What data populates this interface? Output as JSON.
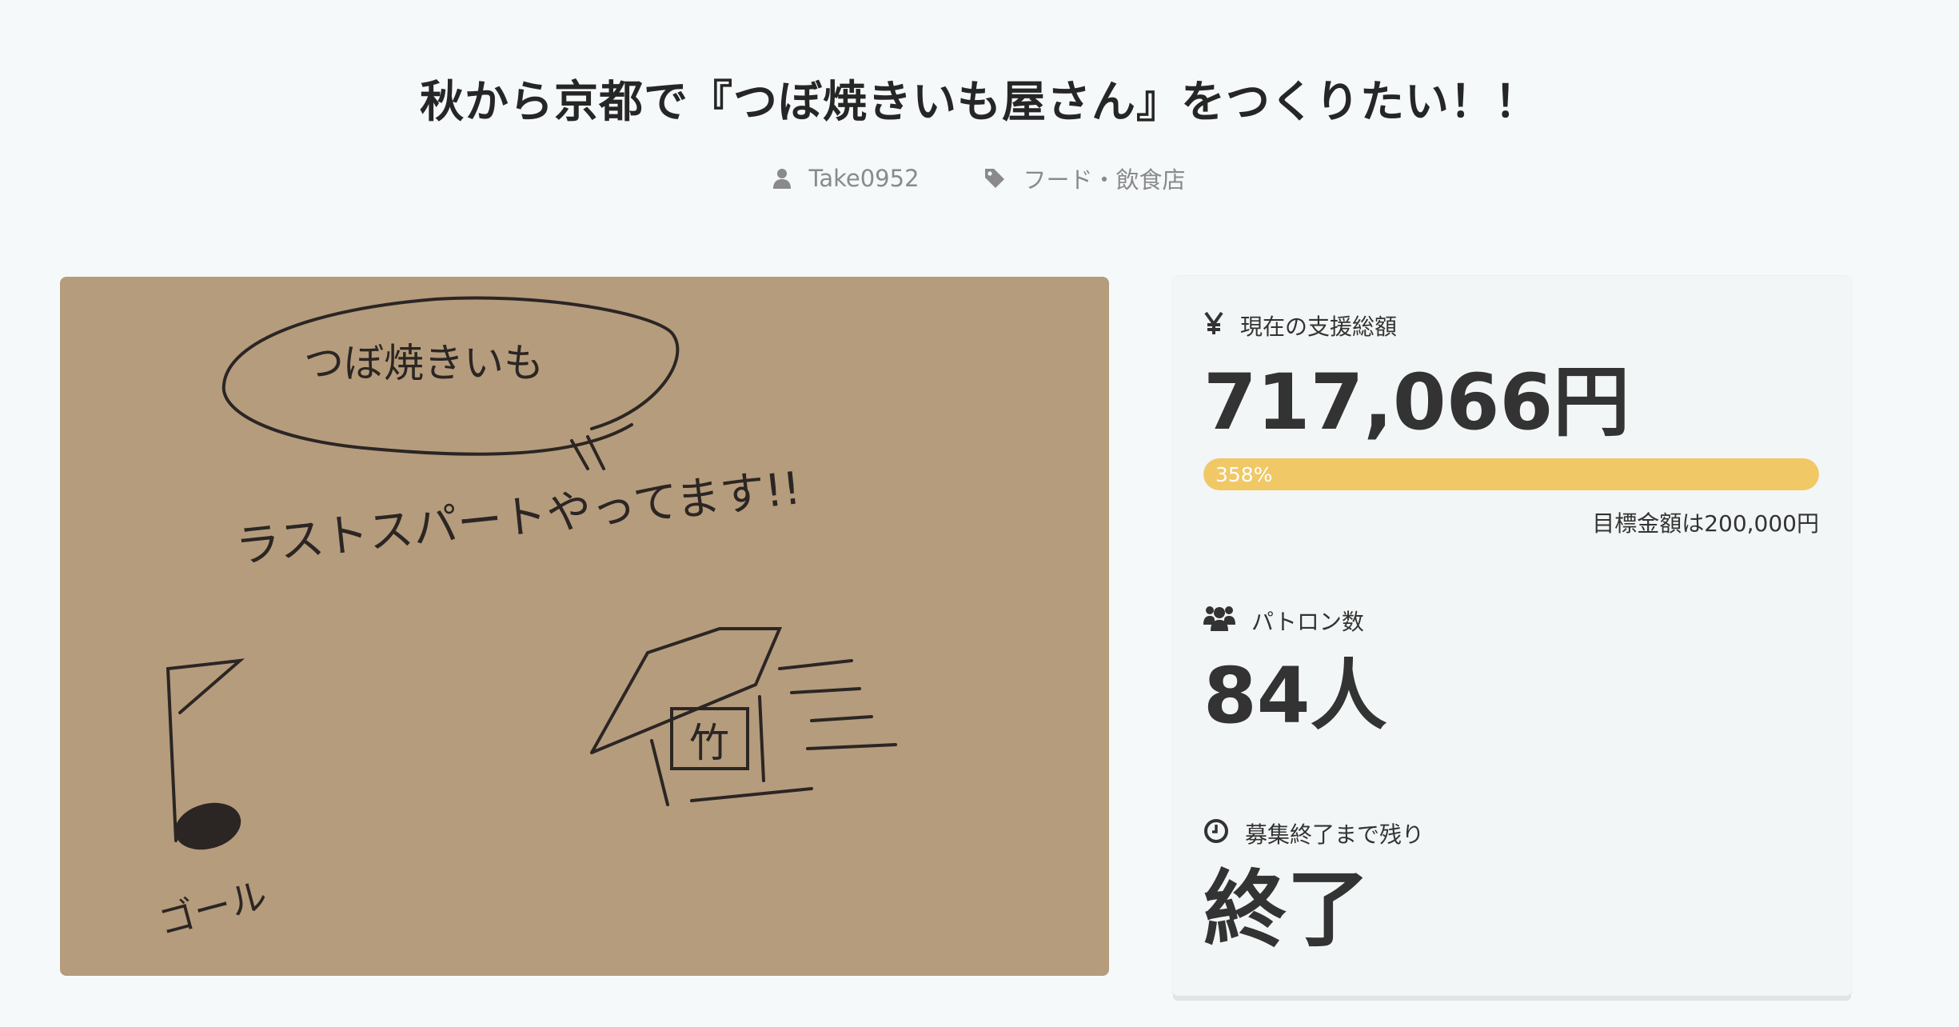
{
  "project": {
    "title": "秋から京都で『つぼ焼きいも屋さん』をつくりたい！！",
    "author": "Take0952",
    "category": "フード・飲食店"
  },
  "hero_image": {
    "bubble_text": "つぼ焼きいも",
    "main_text": "ラストスパートやってます!!",
    "goal_text": "ゴール",
    "shop_sign": "竹"
  },
  "stats": {
    "amount_label": "現在の支援総額",
    "amount_value": "717,066円",
    "progress_text": "358%",
    "progress_percent": 358,
    "goal_text": "目標金額は200,000円",
    "patrons_label": "パトロン数",
    "patrons_value": "84人",
    "remaining_label": "募集終了まで残り",
    "remaining_value": "終了"
  },
  "colors": {
    "background": "#f5f9f9",
    "progress": "#f0c866",
    "text": "#333333",
    "muted": "#8a8a8a"
  },
  "icons": {
    "author": "user-icon",
    "category": "tag-icon",
    "amount": "yen-icon",
    "patrons": "users-icon",
    "remaining": "clock-icon"
  }
}
